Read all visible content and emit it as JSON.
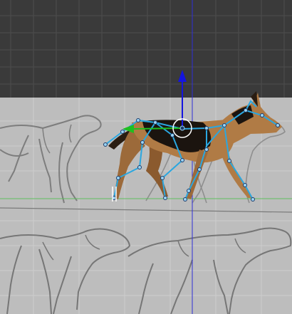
{
  "viewport": {
    "background_color": "#3a3a3a",
    "reference_sheet_color": "#bdbdbd",
    "grid_color": "#4d4d4d",
    "sheet_grid_color": "#cfcfcf",
    "axis_x_color": "#55c055",
    "axis_y_color": "#2f2fd8"
  },
  "rig": {
    "bone_color": "#2aa7e0",
    "joint_color": "#1c3a6a",
    "selected_joint_ring_color": "#ffffff"
  },
  "gizmo": {
    "y_arrow_color": "#1414e0",
    "x_arrow_color": "#1fbf1f",
    "selected_ring_color": "#ffffff"
  },
  "character": {
    "name_icon": "dog-model",
    "coat_dark": "#1b140f",
    "coat_tan": "#b07b45"
  }
}
